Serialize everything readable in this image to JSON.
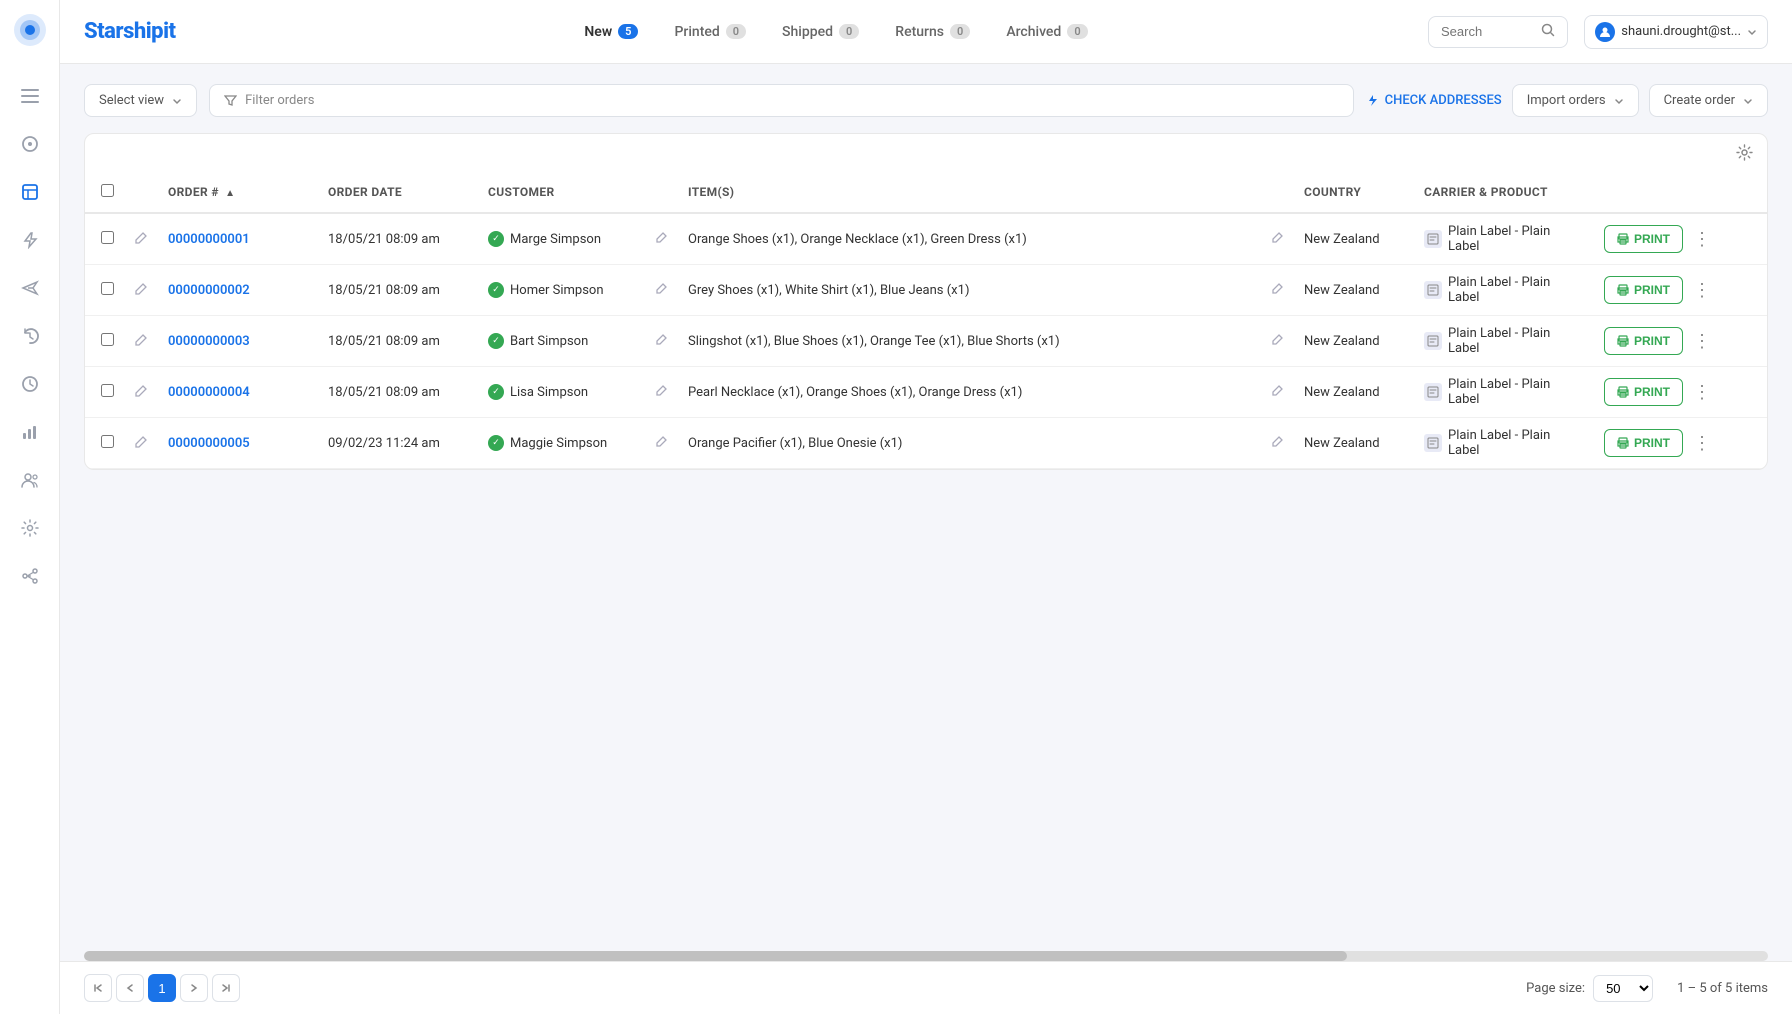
{
  "app": {
    "logo": "Starshipit",
    "logo_color": "#1a73e8"
  },
  "sidebar": {
    "icons": [
      {
        "name": "menu-icon",
        "symbol": "☰"
      },
      {
        "name": "dashboard-icon",
        "symbol": "◎"
      },
      {
        "name": "package-icon",
        "symbol": "⬡"
      },
      {
        "name": "bolt-icon",
        "symbol": "⚡"
      },
      {
        "name": "send-icon",
        "symbol": "➤"
      },
      {
        "name": "history-icon",
        "symbol": "↺"
      },
      {
        "name": "clock-icon",
        "symbol": "⏱"
      },
      {
        "name": "chart-icon",
        "symbol": "↗"
      },
      {
        "name": "users-icon",
        "symbol": "👥"
      },
      {
        "name": "settings-icon",
        "symbol": "⚙"
      },
      {
        "name": "api-icon",
        "symbol": "⌘"
      }
    ]
  },
  "topnav": {
    "tabs": [
      {
        "label": "New",
        "badge": "5",
        "active": true
      },
      {
        "label": "Printed",
        "badge": "0",
        "active": false
      },
      {
        "label": "Shipped",
        "badge": "0",
        "active": false
      },
      {
        "label": "Returns",
        "badge": "0",
        "active": false
      },
      {
        "label": "Archived",
        "badge": "0",
        "active": false
      }
    ],
    "search_placeholder": "Search",
    "user": "shauni.drought@st..."
  },
  "toolbar": {
    "select_view_label": "Select view",
    "filter_label": "Filter orders",
    "check_addresses_label": "CHECK ADDRESSES",
    "import_orders_label": "Import orders",
    "create_order_label": "Create order"
  },
  "table": {
    "columns": [
      {
        "label": "ORDER #",
        "key": "order_num",
        "sort": true
      },
      {
        "label": "ORDER DATE",
        "key": "order_date"
      },
      {
        "label": "CUSTOMER",
        "key": "customer"
      },
      {
        "label": "ITEM(S)",
        "key": "items"
      },
      {
        "label": "COUNTRY",
        "key": "country"
      },
      {
        "label": "CARRIER & PRODUCT",
        "key": "carrier"
      }
    ],
    "rows": [
      {
        "id": "00000000001",
        "date": "18/05/21 08:09 am",
        "customer": "Marge Simpson",
        "items": "Orange Shoes (x1), Orange Necklace (x1), Green Dress (x1)",
        "country": "New Zealand",
        "carrier": "Plain Label - Plain Label",
        "print_label": "PRINT"
      },
      {
        "id": "00000000002",
        "date": "18/05/21 08:09 am",
        "customer": "Homer Simpson",
        "items": "Grey Shoes (x1), White Shirt (x1), Blue Jeans (x1)",
        "country": "New Zealand",
        "carrier": "Plain Label - Plain Label",
        "print_label": "PRINT"
      },
      {
        "id": "00000000003",
        "date": "18/05/21 08:09 am",
        "customer": "Bart Simpson",
        "items": "Slingshot (x1), Blue Shoes (x1), Orange Tee (x1), Blue Shorts (x1)",
        "country": "New Zealand",
        "carrier": "Plain Label - Plain Label",
        "print_label": "PRINT"
      },
      {
        "id": "00000000004",
        "date": "18/05/21 08:09 am",
        "customer": "Lisa Simpson",
        "items": "Pearl Necklace (x1), Orange Shoes (x1), Orange Dress (x1)",
        "country": "New Zealand",
        "carrier": "Plain Label - Plain Label",
        "print_label": "PRINT"
      },
      {
        "id": "00000000005",
        "date": "09/02/23 11:24 am",
        "customer": "Maggie Simpson",
        "items": "Orange Pacifier (x1), Blue Onesie (x1)",
        "country": "New Zealand",
        "carrier": "Plain Label - Plain Label",
        "print_label": "PRINT"
      }
    ]
  },
  "pagination": {
    "current_page": "1",
    "page_size_label": "Page size:",
    "page_size": "50",
    "items_info": "1 – 5 of 5 items"
  }
}
